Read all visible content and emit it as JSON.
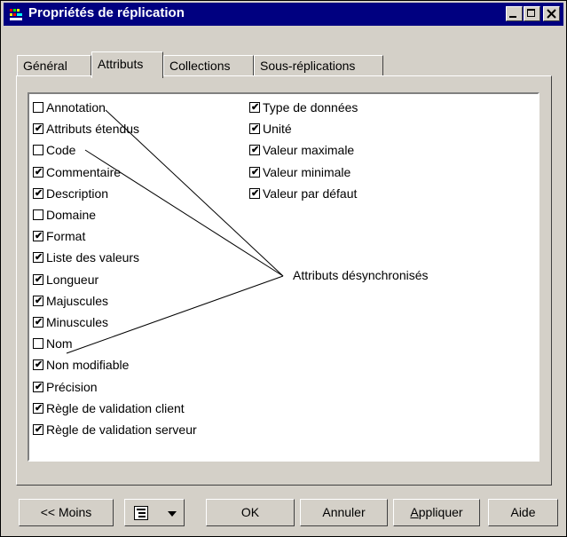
{
  "window": {
    "title": "Propriétés de réplication",
    "controls": [
      "minimize-icon",
      "maximize-icon",
      "close-icon"
    ]
  },
  "tabs": [
    {
      "label": "Général",
      "active": false
    },
    {
      "label": "Attributs",
      "active": true
    },
    {
      "label": "Collections",
      "active": false
    },
    {
      "label": "Sous-réplications",
      "active": false
    }
  ],
  "attributes_left": [
    {
      "label": "Annotation",
      "checked": false
    },
    {
      "label": "Attributs étendus",
      "checked": true
    },
    {
      "label": "Code",
      "checked": false
    },
    {
      "label": "Commentaire",
      "checked": true
    },
    {
      "label": "Description",
      "checked": true
    },
    {
      "label": "Domaine",
      "checked": false
    },
    {
      "label": "Format",
      "checked": true
    },
    {
      "label": "Liste des valeurs",
      "checked": true
    },
    {
      "label": "Longueur",
      "checked": true
    },
    {
      "label": "Majuscules",
      "checked": true
    },
    {
      "label": "Minuscules",
      "checked": true
    },
    {
      "label": "Nom",
      "checked": false
    },
    {
      "label": "Non modifiable",
      "checked": true
    },
    {
      "label": "Précision",
      "checked": true
    },
    {
      "label": "Règle de validation client",
      "checked": true
    },
    {
      "label": "Règle de validation serveur",
      "checked": true
    }
  ],
  "attributes_right": [
    {
      "label": "Type de données",
      "checked": true
    },
    {
      "label": "Unité",
      "checked": true
    },
    {
      "label": "Valeur maximale",
      "checked": true
    },
    {
      "label": "Valeur minimale",
      "checked": true
    },
    {
      "label": "Valeur par défaut",
      "checked": true
    }
  ],
  "callout": {
    "label": "Attributs désynchronisés"
  },
  "buttons": {
    "less": "<< Moins",
    "ok": "OK",
    "cancel": "Annuler",
    "apply": "Appliquer",
    "help": "Aide"
  }
}
